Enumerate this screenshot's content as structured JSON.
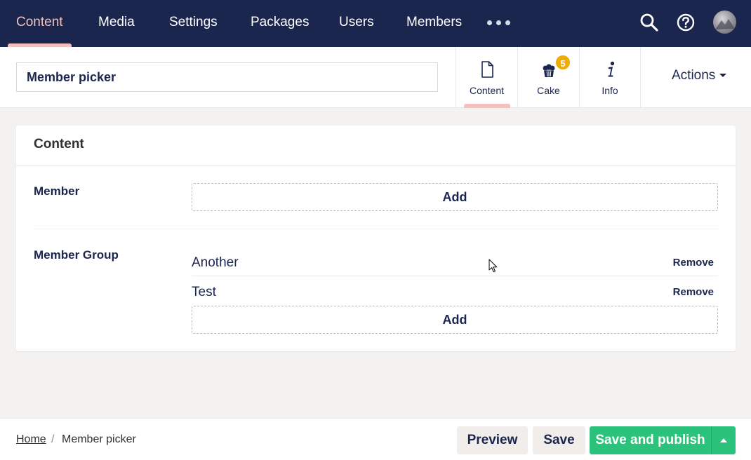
{
  "topnav": {
    "sections": [
      "Content",
      "Media",
      "Settings",
      "Packages",
      "Users",
      "Members"
    ],
    "active": "Content",
    "more_icon": "ellipsis-icon",
    "search_icon": "search-icon",
    "help_icon": "help-icon",
    "avatar": "user-avatar"
  },
  "header": {
    "name_value": "Member picker",
    "apps": [
      {
        "label": "Content",
        "icon": "document-icon",
        "active": true
      },
      {
        "label": "Cake",
        "icon": "cake-icon",
        "badge": "5"
      },
      {
        "label": "Info",
        "icon": "info-icon"
      }
    ],
    "actions_label": "Actions"
  },
  "card": {
    "title": "Content",
    "member": {
      "label": "Member",
      "add_label": "Add"
    },
    "member_group": {
      "label": "Member Group",
      "items": [
        {
          "name": "Another",
          "remove_label": "Remove"
        },
        {
          "name": "Test",
          "remove_label": "Remove"
        }
      ],
      "add_label": "Add"
    }
  },
  "footer": {
    "breadcrumb": {
      "home": "Home",
      "separator": "/",
      "current": "Member picker"
    },
    "preview_label": "Preview",
    "save_label": "Save",
    "save_publish_label": "Save and publish"
  },
  "colors": {
    "nav_bg": "#1b264f",
    "accent": "#f5c1bc",
    "publish": "#2bc37c",
    "badge": "#f0ac00"
  }
}
